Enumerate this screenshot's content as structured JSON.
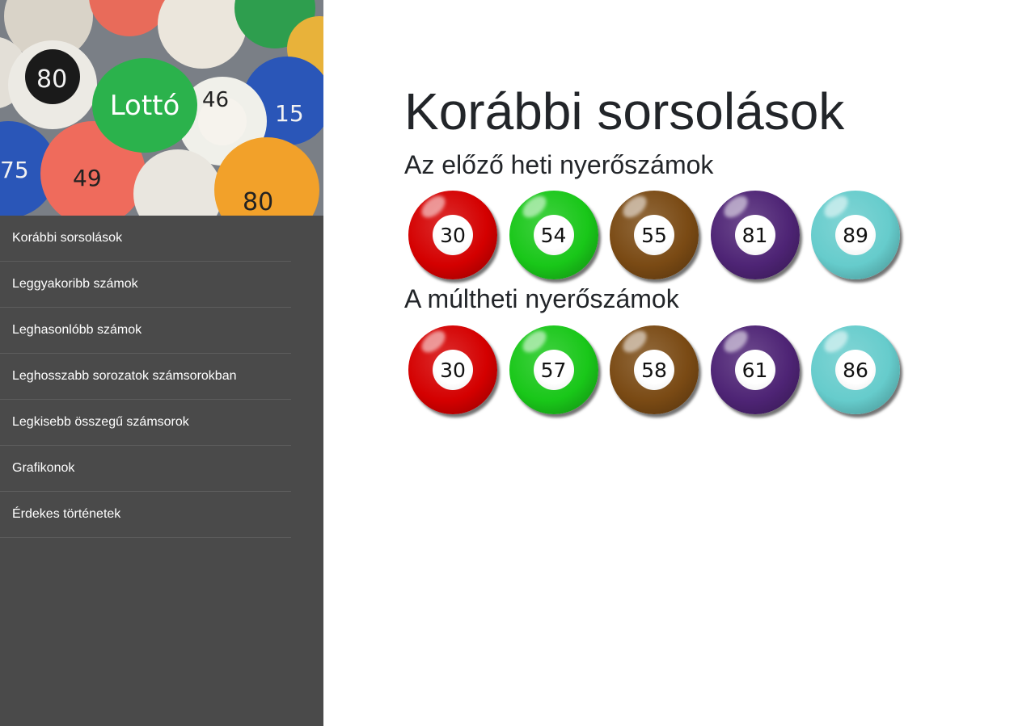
{
  "brand": {
    "logo_text": "Lottó",
    "logo_color": "#2bb24c"
  },
  "sidebar": {
    "items": [
      {
        "label": "Korábbi sorsolások"
      },
      {
        "label": "Leggyakoribb számok"
      },
      {
        "label": "Leghasonlóbb számok"
      },
      {
        "label": "Leghosszabb sorozatok számsorokban"
      },
      {
        "label": "Legkisebb összegű számsorok"
      },
      {
        "label": "Grafikonok"
      },
      {
        "label": "Érdekes történetek"
      }
    ]
  },
  "main": {
    "title": "Korábbi sorsolások",
    "sections": [
      {
        "heading": "Az előző heti nyerőszámok",
        "numbers": [
          30,
          54,
          55,
          81,
          89
        ]
      },
      {
        "heading": "A múltheti nyerőszámok",
        "numbers": [
          30,
          57,
          58,
          61,
          86
        ]
      }
    ],
    "ball_colors": [
      "#d40000",
      "#19c719",
      "#7a4a14",
      "#4e2475",
      "#66cccc"
    ]
  }
}
